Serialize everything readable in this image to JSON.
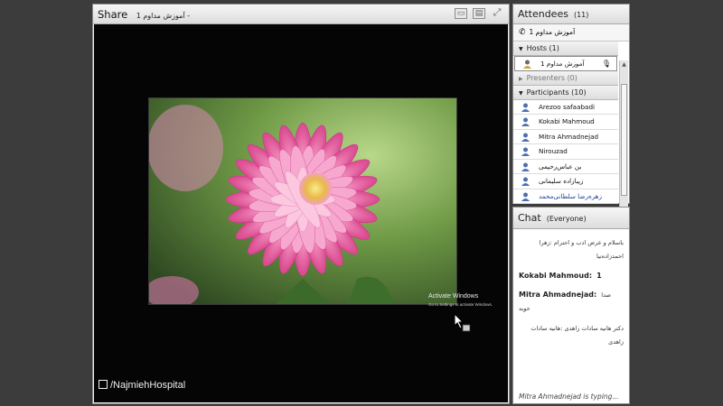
{
  "share": {
    "title": "Share",
    "subtitle": "آموزش مداوم 1 -",
    "icons": [
      "layout-icon",
      "presentation-icon",
      "fullscreen-icon"
    ],
    "watermark": "/NajmiehHospital",
    "activate_title": "Activate Windows",
    "activate_sub": "Go to Settings to activate Windows."
  },
  "attendees": {
    "title": "Attendees",
    "count": "(11)",
    "meeting_name": "آموزش مداوم 1",
    "hosts_label": "Hosts (1)",
    "host_name": "آموزش مداوم 1",
    "presenters_label": "Presenters (0)",
    "participants_label": "Participants (10)",
    "participants": [
      "Arezoo safaabadi",
      "Kokabi Mahmoud",
      "Mitra Ahmadnejad",
      "Nirouzad",
      "بن عباس‌رحیمی",
      "زیبا‌زاده سلیمانی",
      "زهره‌رضا‌ سلطانی‌محمد"
    ]
  },
  "chat": {
    "title": "Chat",
    "scope": "(Everyone)",
    "messages": [
      {
        "who": "",
        "text": "باسلام و عرض ادب و احترام :زهرا احمدزاده‌نیا"
      },
      {
        "who": "Kokabi Mahmoud:",
        "text": "1"
      },
      {
        "who": "Mitra Ahmadnejad:",
        "text": "صدا خوبه"
      },
      {
        "who": "",
        "text": "دکتر هانیه سادات زاهدی :هانیه سادات زاهدی"
      }
    ],
    "typing": "Mitra Ahmadnejad is typing..."
  }
}
